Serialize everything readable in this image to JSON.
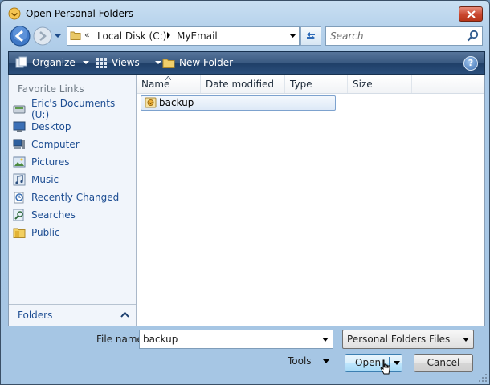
{
  "window": {
    "title": "Open Personal Folders"
  },
  "nav": {
    "address": {
      "chevron": "«",
      "segments": [
        "Local Disk (C:)",
        "MyEmail"
      ]
    },
    "search": {
      "placeholder": "Search"
    }
  },
  "toolbar": {
    "organize_label": "Organize",
    "views_label": "Views",
    "new_folder_label": "New Folder",
    "help_label": "?"
  },
  "sidebar": {
    "header": "Favorite Links",
    "items": [
      {
        "label": "Eric's Documents (U:)",
        "icon": "documents-icon"
      },
      {
        "label": "Desktop",
        "icon": "desktop-icon"
      },
      {
        "label": "Computer",
        "icon": "computer-icon"
      },
      {
        "label": "Pictures",
        "icon": "pictures-icon"
      },
      {
        "label": "Music",
        "icon": "music-icon"
      },
      {
        "label": "Recently Changed",
        "icon": "recent-icon"
      },
      {
        "label": "Searches",
        "icon": "searches-icon"
      },
      {
        "label": "Public",
        "icon": "public-folder-icon"
      }
    ],
    "folders_label": "Folders"
  },
  "file_list": {
    "columns": [
      "Name",
      "Date modified",
      "Type",
      "Size"
    ],
    "sorted_column": "Name",
    "rows": [
      {
        "name": "backup",
        "selected": true,
        "icon": "pst-file-icon"
      }
    ]
  },
  "footer": {
    "file_name_label": "File name:",
    "file_name_value": "backup",
    "file_type_value": "Personal Folders Files",
    "tools_label": "Tools",
    "open_label": "Open",
    "cancel_label": "Cancel"
  },
  "colors": {
    "toolbar_top": "#56749a",
    "toolbar_bottom": "#1f3f68",
    "link_text": "#1d4d92",
    "close_button": "#c9462e",
    "selection": "#dde9f7"
  }
}
